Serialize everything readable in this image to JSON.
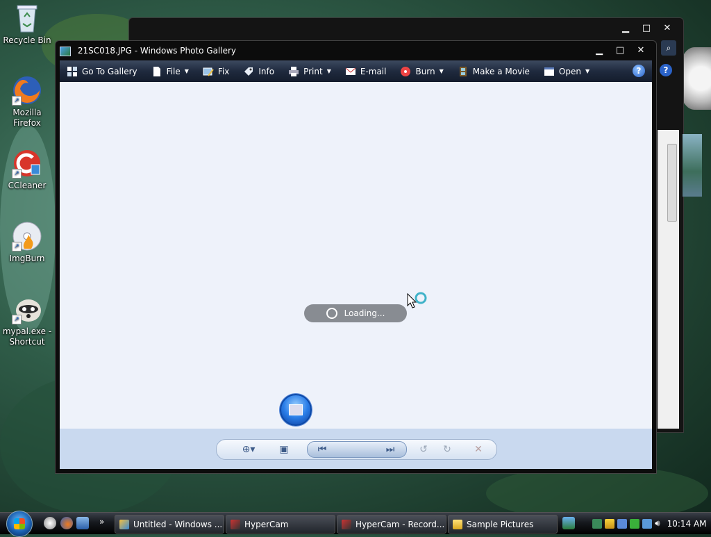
{
  "desktop": {
    "icons": [
      {
        "label": "Recycle Bin",
        "icon": "recycle-bin-icon"
      },
      {
        "label": "Mozilla Firefox",
        "icon": "firefox-icon"
      },
      {
        "label": "CCleaner",
        "icon": "ccleaner-icon"
      },
      {
        "label": "ImgBurn",
        "icon": "imgburn-icon"
      },
      {
        "label": "mypal.exe - Shortcut",
        "icon": "mypal-icon"
      }
    ]
  },
  "main_window": {
    "title": "21SC018.JPG - Windows Photo Gallery",
    "controls": {
      "minimize": "▁",
      "maximize": "□",
      "close": "✕"
    },
    "toolbar": {
      "go_to_gallery": "Go To Gallery",
      "file": "File",
      "fix": "Fix",
      "info": "Info",
      "print": "Print",
      "email": "E-mail",
      "burn": "Burn",
      "make_movie": "Make a Movie",
      "open": "Open",
      "help": "?"
    },
    "loading_text": "Loading..."
  },
  "taskbar": {
    "tasks": [
      {
        "label": "Untitled - Windows ...",
        "icon": "paint-icon"
      },
      {
        "label": "HyperCam",
        "icon": "hypercam-icon"
      },
      {
        "label": "HyperCam - Record...",
        "icon": "hypercam-icon"
      },
      {
        "label": "Sample Pictures",
        "icon": "folder-icon"
      }
    ],
    "overflow": "»",
    "time": "10:14 AM"
  },
  "colors": {
    "accent": "#2b7ee8",
    "viewer_bg": "#eef2fa",
    "control_bar": "#c9d9ef"
  }
}
